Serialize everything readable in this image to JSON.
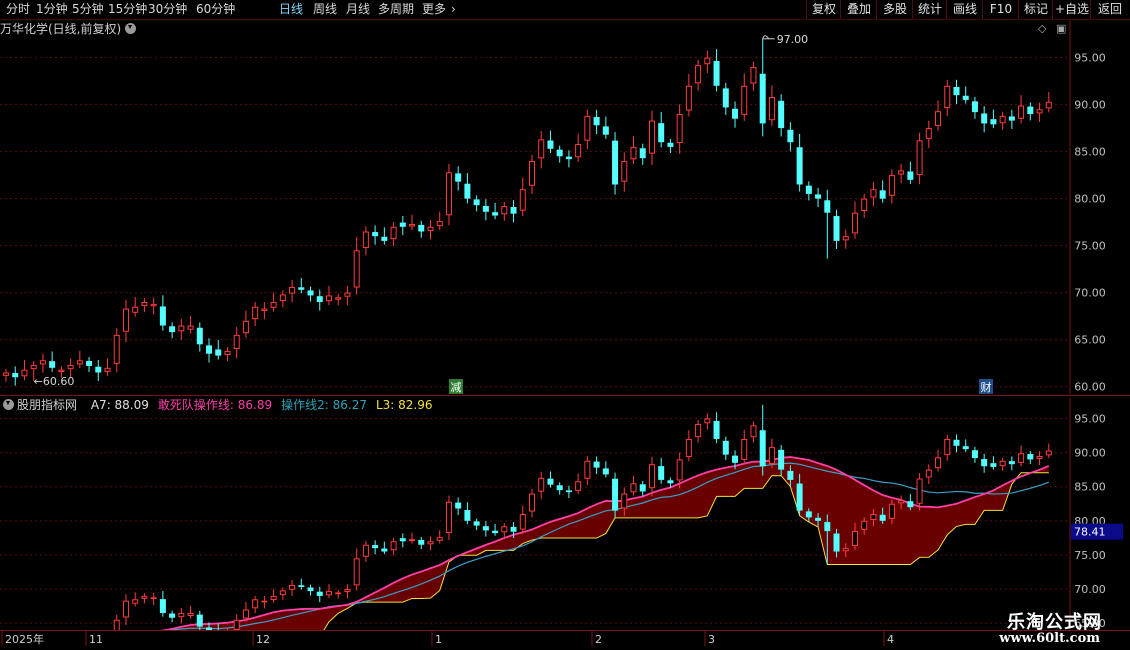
{
  "toolbar": {
    "periods": [
      {
        "label": "分时",
        "active": false
      },
      {
        "label": "1分钟",
        "active": false
      },
      {
        "label": "5分钟",
        "active": false
      },
      {
        "label": "15分钟",
        "active": false
      },
      {
        "label": "30分钟",
        "active": false
      },
      {
        "label": "60分钟",
        "active": false
      },
      {
        "label": "日线",
        "active": true
      },
      {
        "label": "周线",
        "active": false
      },
      {
        "label": "月线",
        "active": false
      },
      {
        "label": "多周期",
        "active": false
      },
      {
        "label": "更多",
        "active": false
      }
    ],
    "more_icon": "chevron-right-icon",
    "buttons": [
      "复权",
      "叠加",
      "多股",
      "统计",
      "画线",
      "F10",
      "标记",
      "+自选",
      "返回"
    ]
  },
  "main_chart": {
    "title": "万华化学(日线,前复权)",
    "title_icon": "chevron-down-circle-icon",
    "high_label": "97.00",
    "low_label": "60.60",
    "markers": [
      "减",
      "财"
    ],
    "y_ticks": [
      "95.00",
      "90.00",
      "85.00",
      "80.00",
      "75.00",
      "70.00",
      "65.00",
      "60.00"
    ],
    "y_range": [
      59,
      99
    ]
  },
  "indicator": {
    "name": "股朋指标网",
    "icon": "chevron-down-circle-icon",
    "items": [
      {
        "label": "A7: 88.09",
        "color": "#e0e0e0"
      },
      {
        "label": "敢死队操作线: 86.89",
        "color": "#ff3fa8"
      },
      {
        "label": "操作线2: 86.27",
        "color": "#2aa3b8"
      },
      {
        "label": "L3: 82.96",
        "color": "#f2e23a"
      }
    ],
    "y_ticks": [
      "95.00",
      "90.00",
      "85.00",
      "80.00",
      "75.00",
      "70.00",
      "65.00"
    ],
    "y_range": [
      64,
      98
    ],
    "current_value": "78.41"
  },
  "x_axis": {
    "labels": [
      "2025年",
      "11",
      "12",
      "1",
      "2",
      "3",
      "4"
    ]
  },
  "watermark": {
    "line1": "乐淘公式网",
    "line2": "www.60lt.com"
  },
  "colors": {
    "up": "#ff3b3b",
    "down": "#54ffff",
    "grid": "#5a0d0d",
    "band": "#7a0000",
    "magenta_line": "#ff3fa8",
    "teal_line": "#3aa0c8",
    "yellow_line": "#f2e23a",
    "axis_text": "#c8c8c8"
  },
  "chart_data": {
    "type": "candlestick",
    "closes": [
      61.5,
      61.0,
      61.8,
      62.3,
      62.8,
      62.0,
      61.8,
      62.3,
      62.8,
      62.2,
      61.5,
      62.0,
      65.5,
      68.3,
      68.5,
      69.0,
      68.8,
      66.5,
      65.8,
      66.5,
      66.5,
      64.5,
      63.5,
      63.3,
      63.8,
      65.5,
      67.0,
      68.5,
      68.3,
      69.0,
      69.8,
      70.6,
      70.3,
      69.7,
      69.0,
      69.7,
      69.5,
      70.0,
      74.5,
      76.5,
      76.0,
      75.5,
      77.0,
      77.0,
      77.3,
      76.5,
      77.0,
      77.6,
      82.8,
      81.8,
      80.0,
      79.3,
      78.6,
      78.2,
      79.2,
      78.4,
      81.0,
      84.0,
      86.3,
      85.3,
      84.5,
      84.2,
      85.8,
      88.8,
      87.8,
      86.8,
      81.5,
      84.0,
      85.5,
      84.3,
      88.3,
      86.0,
      85.5,
      89.0,
      92.0,
      94.2,
      95.0,
      92.0,
      89.7,
      88.5,
      92.0,
      94.0,
      88.0,
      90.8,
      87.5,
      86.0,
      81.5,
      80.5,
      80.0,
      78.5,
      75.5,
      76.0,
      78.5,
      80.0,
      81.0,
      80.0,
      82.5,
      83.0,
      82.0,
      86.2,
      87.5,
      89.3,
      92.0,
      91.0,
      90.5,
      89.2,
      88.0,
      87.9,
      88.8,
      88.3,
      89.9,
      89.0,
      89.5,
      90.3
    ],
    "overlay_lines": {
      "A7_last": 88.09,
      "敢死队操作线_last": 86.89,
      "操作线2_last": 86.27,
      "L3_last": 82.96
    },
    "ylim_main": [
      59,
      99
    ],
    "ylim_indicator": [
      64,
      98
    ]
  }
}
